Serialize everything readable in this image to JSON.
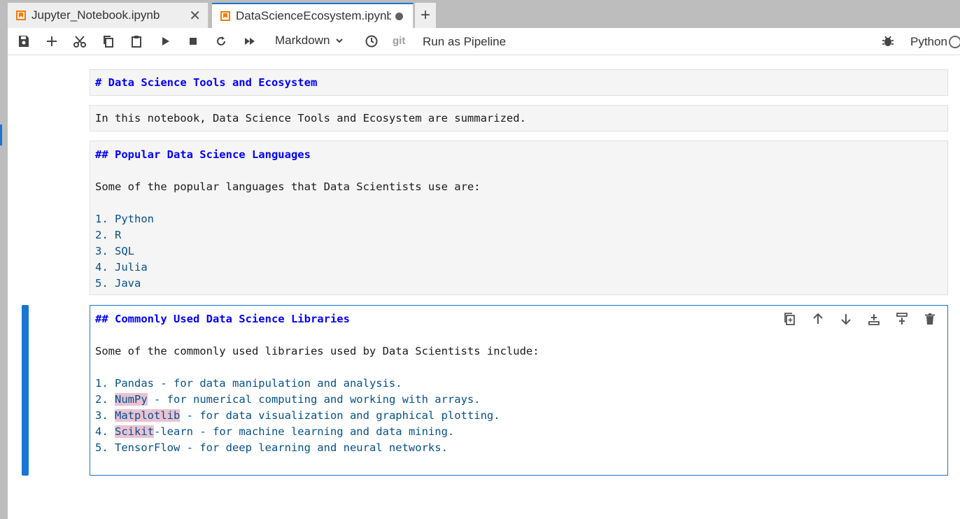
{
  "tabs": [
    {
      "label": "Jupyter_Notebook.ipynb",
      "icon": "notebook-icon",
      "close": "✕"
    },
    {
      "label": "DataScienceEcosystem.ipynb",
      "icon": "notebook-icon",
      "dirty": true
    }
  ],
  "new_tab": "+",
  "toolbar": {
    "cell_type": "Markdown",
    "git": "git",
    "run_pipeline": "Run as Pipeline",
    "kernel": "Python"
  },
  "cells": [
    {
      "lines": [
        "# Data Science Tools and Ecosystem"
      ]
    },
    {
      "lines": [
        "In this notebook, Data Science Tools and Ecosystem are summarized."
      ]
    },
    {
      "lines": [
        "## Popular Data Science Languages",
        "",
        "Some of the popular languages that Data Scientists use are:",
        "",
        "1. Python",
        "2. R",
        "3. SQL",
        "4. Julia",
        "5. Java"
      ]
    },
    {
      "lines": [
        "## Commonly Used Data Science Libraries",
        "",
        "Some of the commonly used libraries used by Data Scientists include:",
        ""
      ],
      "items": [
        {
          "num": "1. ",
          "hl": "",
          "text": "Pandas - for data manipulation and analysis."
        },
        {
          "num": "2. ",
          "hl": "NumPy",
          "text": " - for numerical computing and working with arrays."
        },
        {
          "num": "3. ",
          "hl": "Matplotlib",
          "text": " - for data visualization and graphical plotting."
        },
        {
          "num": "4. ",
          "hl": "Scikit",
          "text": "-learn - for machine learning and data mining."
        },
        {
          "num": "5. ",
          "hl": "",
          "text": "TensorFlow - for deep learning and neural networks."
        }
      ]
    }
  ],
  "colors": {
    "accent": "#1976d2",
    "header": "#0000ff",
    "list": "#05508a",
    "highlight": "#e9c3d3"
  }
}
